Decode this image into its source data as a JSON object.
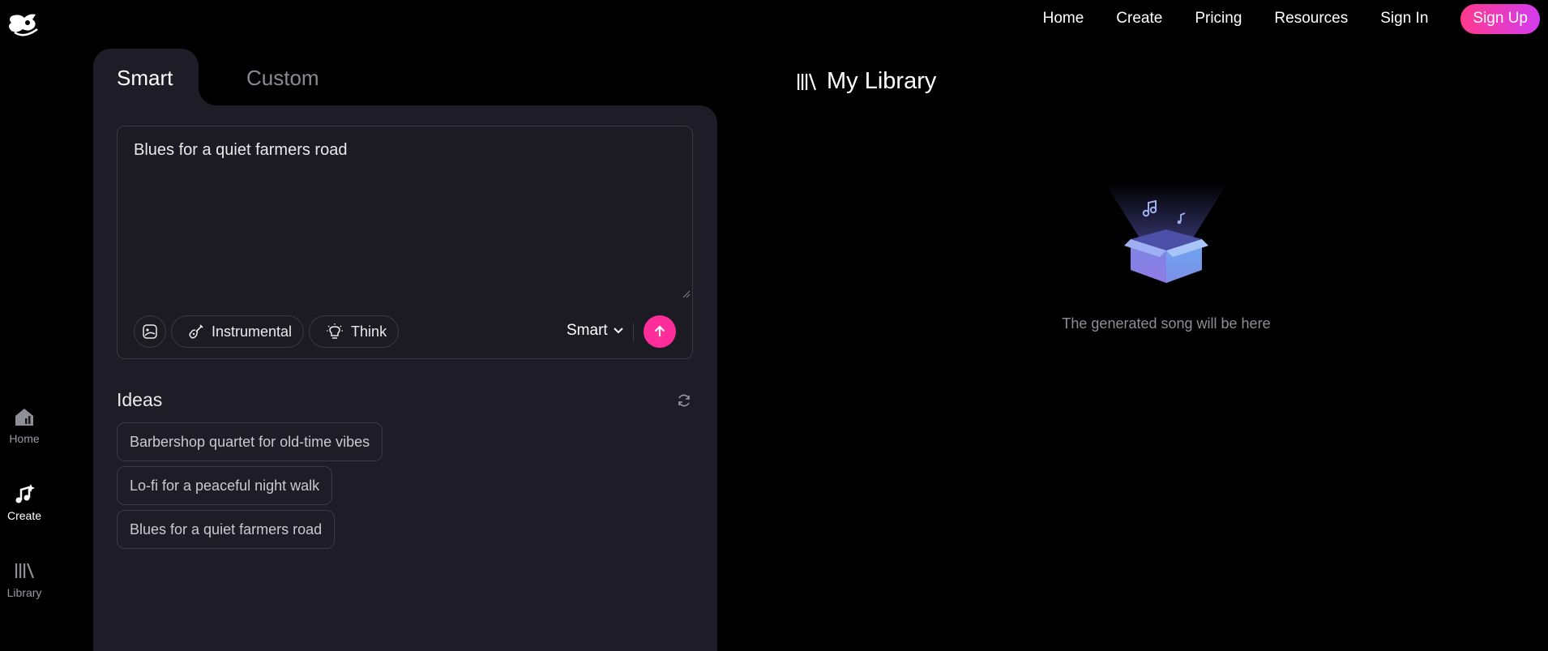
{
  "nav": {
    "links": [
      "Home",
      "Create",
      "Pricing",
      "Resources",
      "Sign In"
    ],
    "signup_label": "Sign Up"
  },
  "sidebar": {
    "items": [
      {
        "label": "Home",
        "icon": "home-icon",
        "active": false
      },
      {
        "label": "Create",
        "icon": "music-note-sparkle-icon",
        "active": true
      },
      {
        "label": "Library",
        "icon": "library-icon",
        "active": false
      }
    ]
  },
  "tabs": {
    "smart": "Smart",
    "custom": "Custom"
  },
  "prompt": {
    "value": "Blues for a quiet farmers road",
    "instrumental_label": "Instrumental",
    "think_label": "Think",
    "mode_label": "Smart"
  },
  "ideas": {
    "title": "Ideas",
    "items": [
      "Barbershop quartet for old-time vibes",
      "Lo-fi for a peaceful night walk",
      "Blues for a quiet farmers road"
    ]
  },
  "library": {
    "title": "My Library",
    "empty_text": "The generated song will be here"
  },
  "colors": {
    "accent": "#ff2d9a",
    "panel_bg": "#1e1d27",
    "gradient_start": "#ff3a8c",
    "gradient_end": "#d23cf0"
  }
}
